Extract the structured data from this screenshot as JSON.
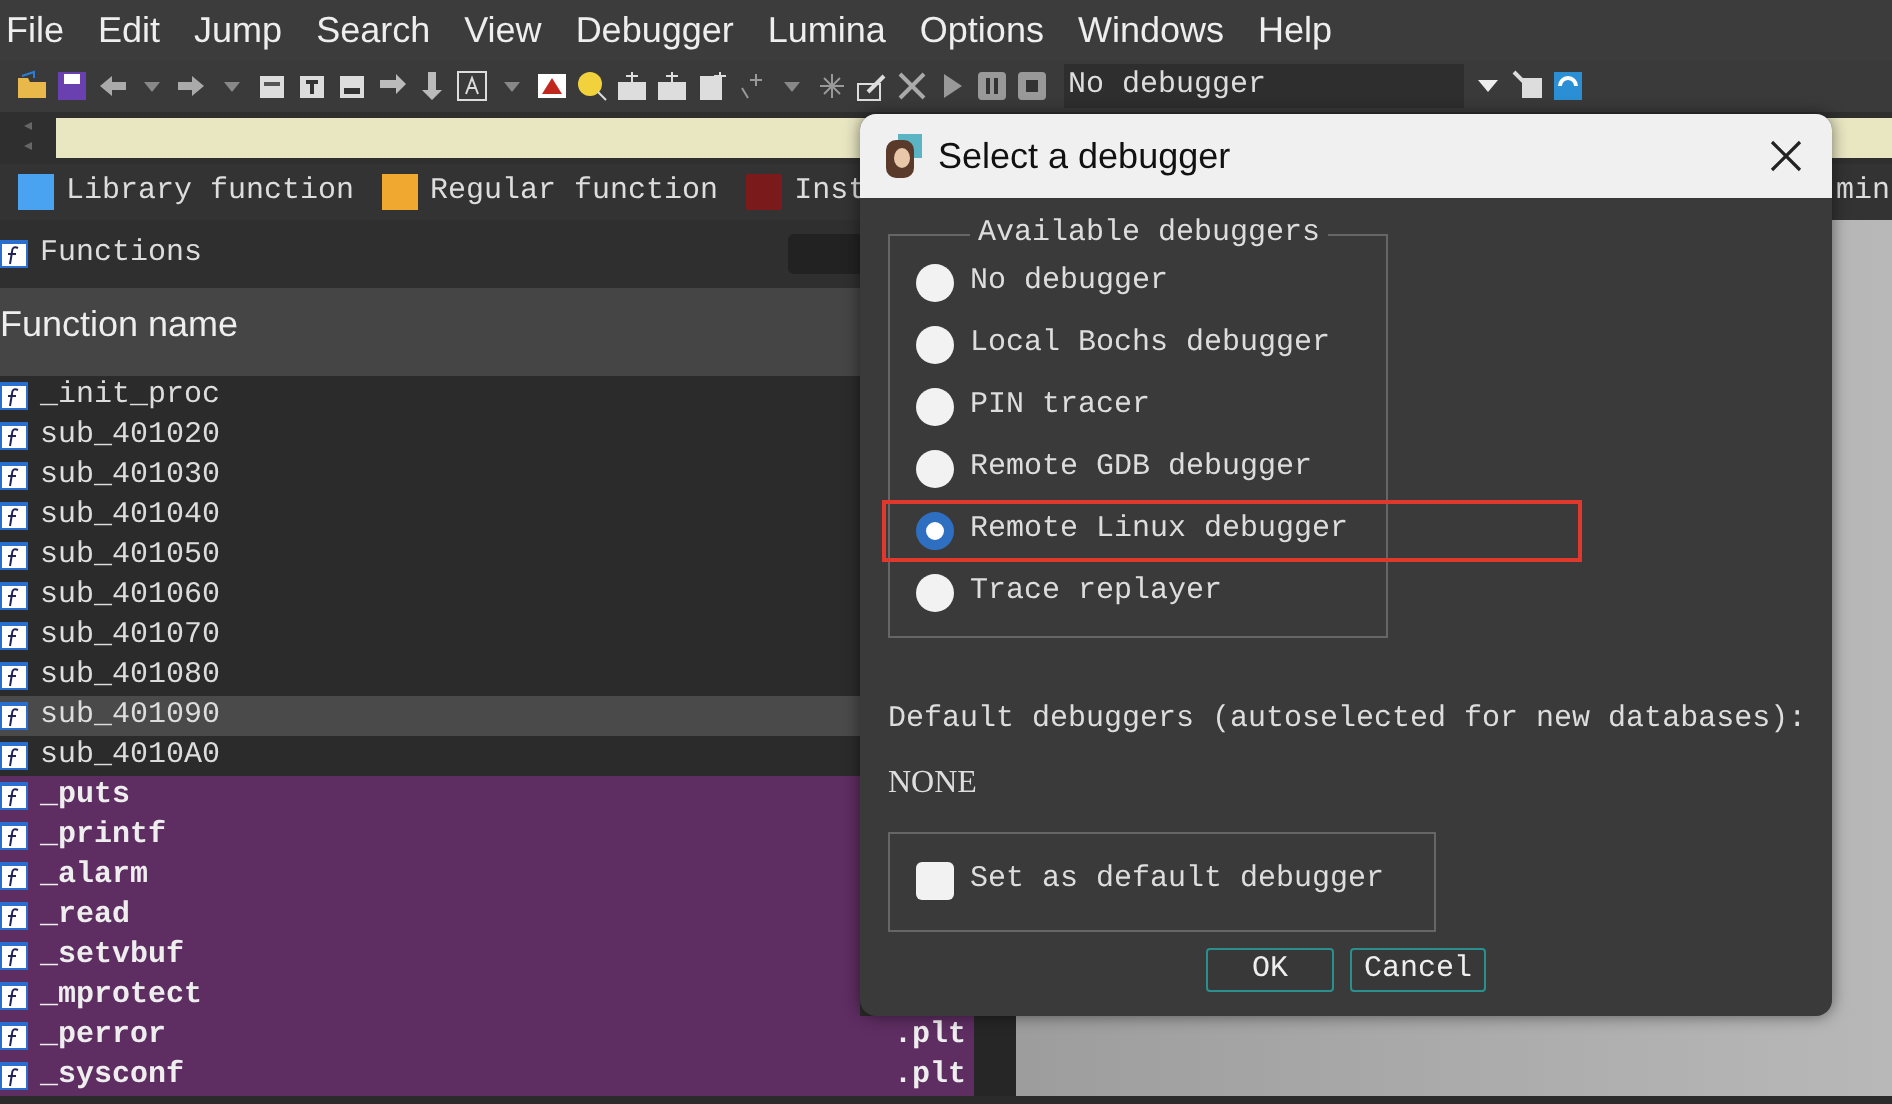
{
  "menu": [
    "File",
    "Edit",
    "Jump",
    "Search",
    "View",
    "Debugger",
    "Lumina",
    "Options",
    "Windows",
    "Help"
  ],
  "toolbar": {
    "debugger_select": "No debugger"
  },
  "legend": [
    {
      "label": "Library function",
      "color": "#4aa3f0"
    },
    {
      "label": "Regular function",
      "color": "#f0a830"
    },
    {
      "label": "Inst",
      "color": "#7a1a1a"
    }
  ],
  "legend_tail": "min",
  "functions_panel": {
    "title": "Functions",
    "columns": [
      "Function name"
    ],
    "rows": [
      {
        "name": "_init_proc",
        "kind": "regular",
        "selected": false
      },
      {
        "name": "sub_401020",
        "kind": "regular",
        "selected": false
      },
      {
        "name": "sub_401030",
        "kind": "regular",
        "selected": false
      },
      {
        "name": "sub_401040",
        "kind": "regular",
        "selected": false
      },
      {
        "name": "sub_401050",
        "kind": "regular",
        "selected": false
      },
      {
        "name": "sub_401060",
        "kind": "regular",
        "selected": false
      },
      {
        "name": "sub_401070",
        "kind": "regular",
        "selected": false
      },
      {
        "name": "sub_401080",
        "kind": "regular",
        "selected": false
      },
      {
        "name": "sub_401090",
        "kind": "regular",
        "selected": true
      },
      {
        "name": "sub_4010A0",
        "kind": "regular",
        "selected": false
      },
      {
        "name": "_puts",
        "kind": "import",
        "selected": false
      },
      {
        "name": "_printf",
        "kind": "import",
        "selected": false
      },
      {
        "name": "_alarm",
        "kind": "import",
        "selected": false
      },
      {
        "name": "_read",
        "kind": "import",
        "selected": false
      },
      {
        "name": "_setvbuf",
        "kind": "import",
        "selected": false
      },
      {
        "name": "_mprotect",
        "kind": "import",
        "selected": false
      },
      {
        "name": "_perror",
        "kind": "import",
        "selected": false,
        "segment": ".plt"
      },
      {
        "name": "_sysconf",
        "kind": "import",
        "selected": false,
        "segment": ".plt"
      }
    ]
  },
  "dialog": {
    "title": "Select a debugger",
    "group_title": "Available debuggers",
    "options": [
      {
        "label": "No debugger",
        "selected": false,
        "highlighted": false
      },
      {
        "label": "Local Bochs debugger",
        "selected": false,
        "highlighted": false
      },
      {
        "label": "PIN tracer",
        "selected": false,
        "highlighted": false
      },
      {
        "label": "Remote GDB debugger",
        "selected": false,
        "highlighted": false
      },
      {
        "label": "Remote Linux debugger",
        "selected": true,
        "highlighted": true
      },
      {
        "label": "Trace replayer",
        "selected": false,
        "highlighted": false
      }
    ],
    "default_label": "Default debuggers (autoselected for new databases):",
    "default_value": "NONE",
    "set_default": {
      "label": "Set as default debugger",
      "checked": false
    },
    "buttons": [
      "OK",
      "Cancel"
    ]
  }
}
